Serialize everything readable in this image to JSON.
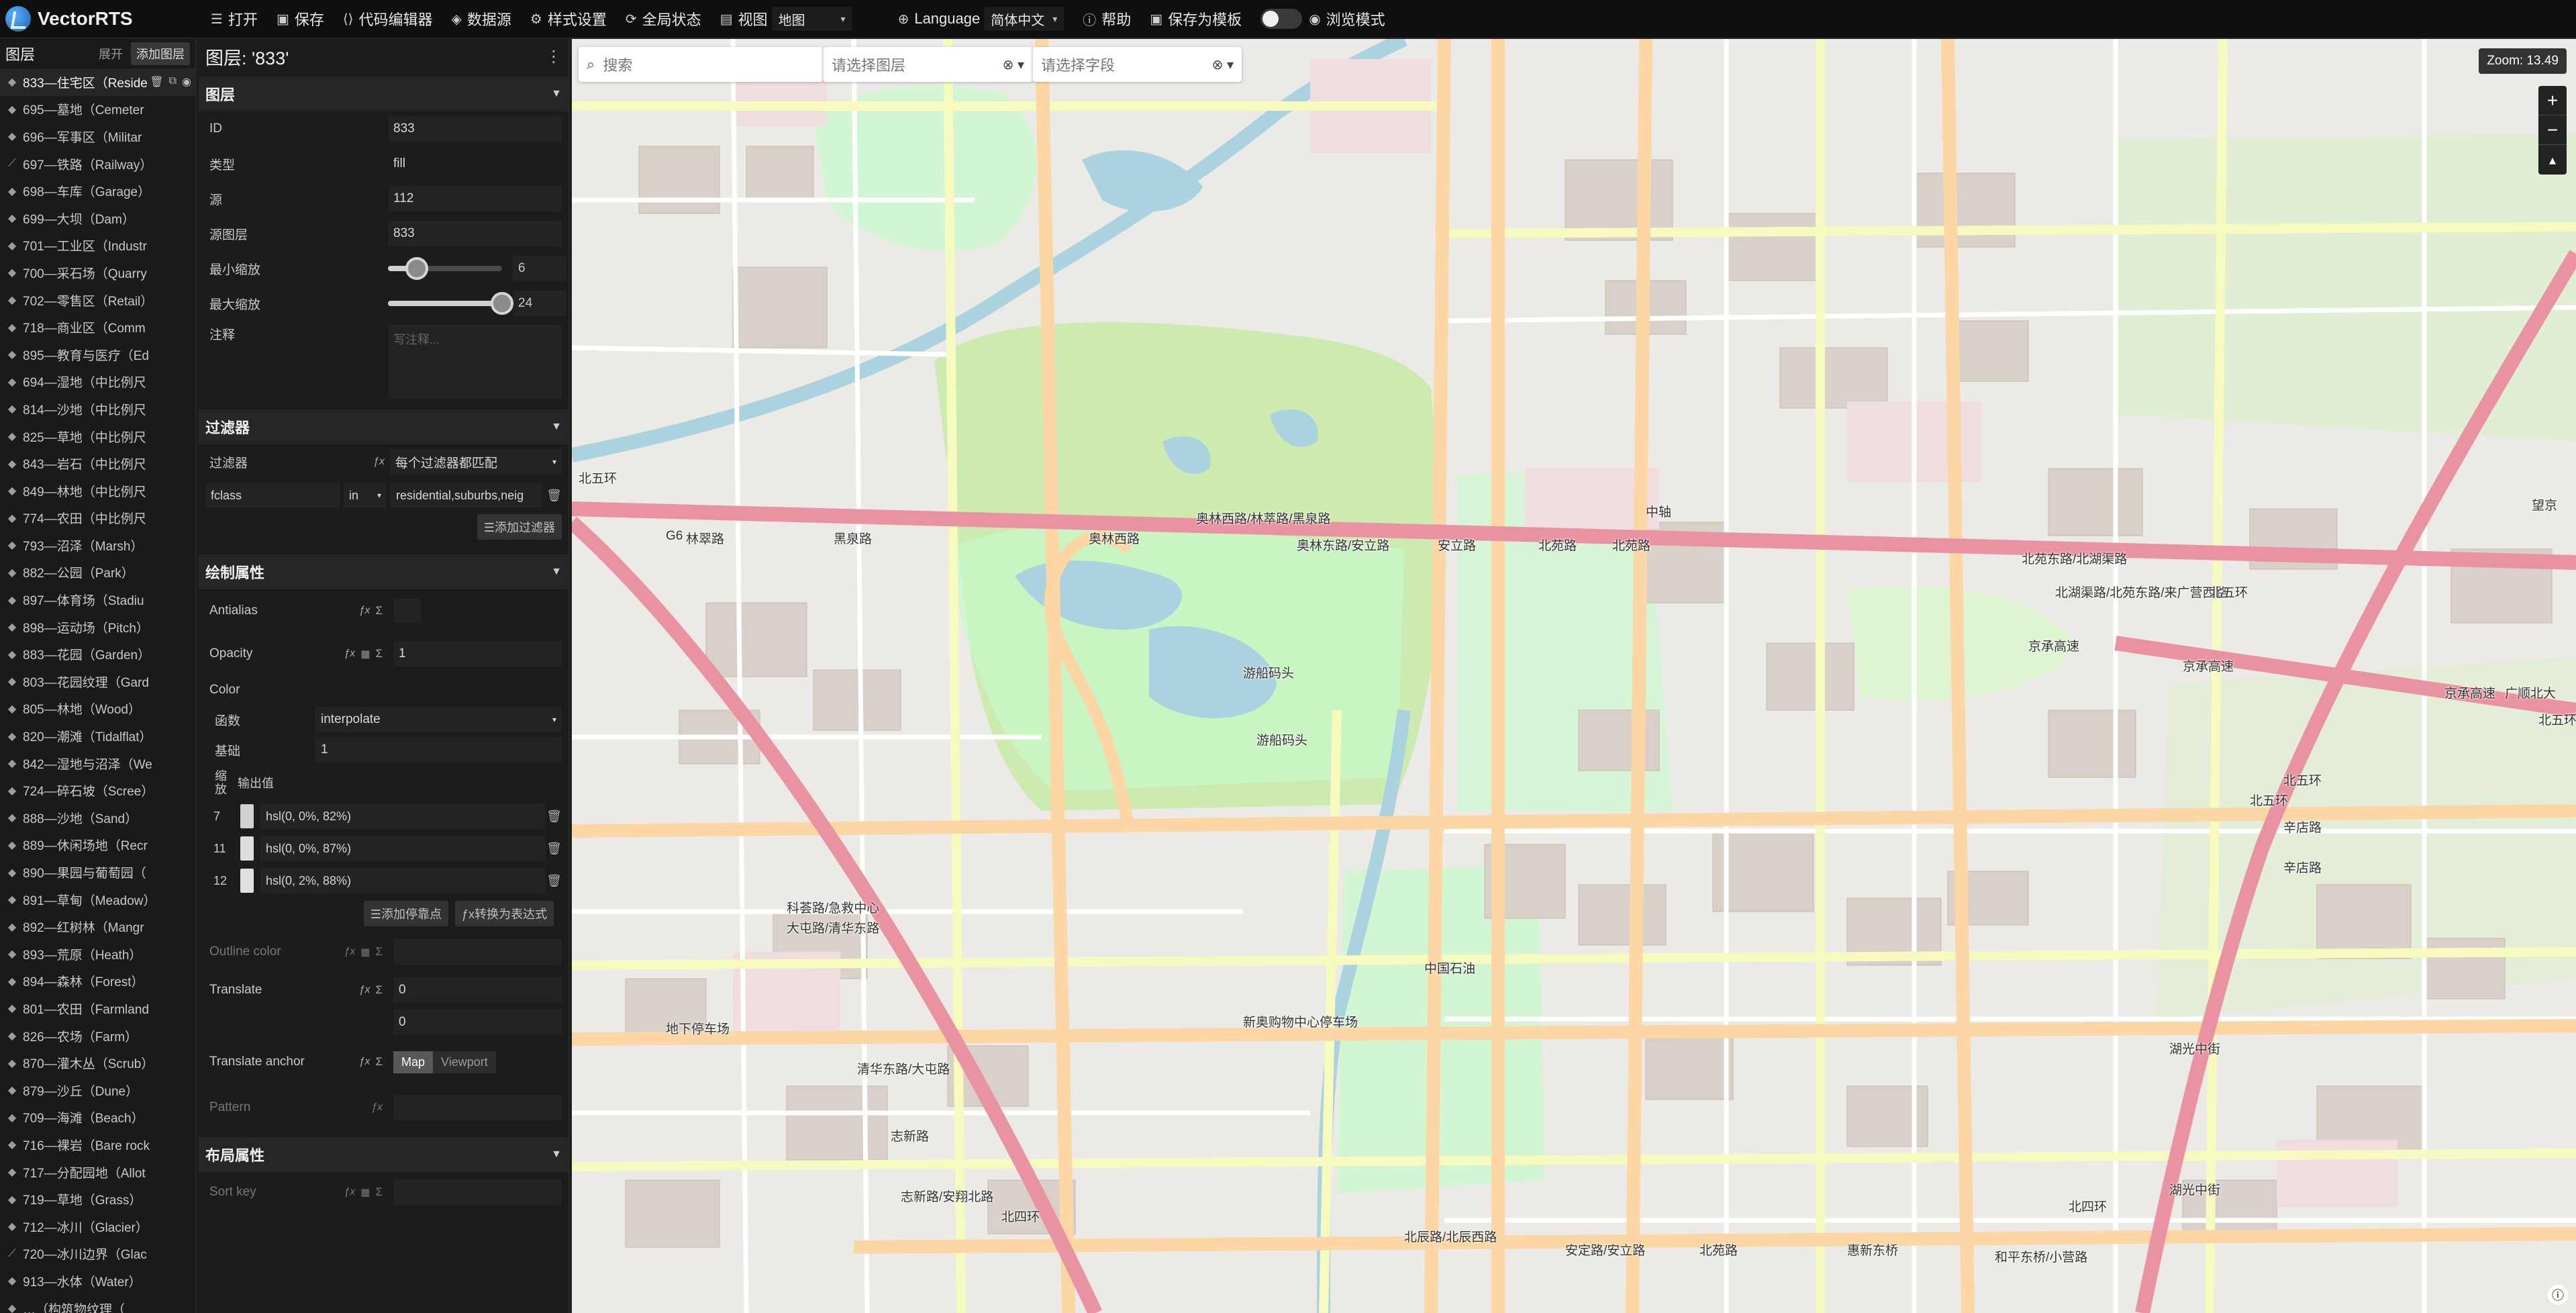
{
  "app": {
    "name": "VectorRTS"
  },
  "toolbar": {
    "open": "打开",
    "save": "保存",
    "code_editor": "代码编辑器",
    "datasource": "数据源",
    "style_settings": "样式设置",
    "global_state": "全局状态",
    "view": "视图",
    "view_select": "地图",
    "language": "Language",
    "language_select": "简体中文",
    "help": "帮助",
    "save_template": "保存为模板",
    "browse_mode": "浏览模式"
  },
  "layers_panel": {
    "title": "图层",
    "expand": "展开",
    "add": "添加图层",
    "items": [
      {
        "label": "833—住宅区（Reside",
        "icon": "fill"
      },
      {
        "label": "695—墓地（Cemeter",
        "icon": "fill"
      },
      {
        "label": "696—军事区（Militar",
        "icon": "fill"
      },
      {
        "label": "697—铁路（Railway）",
        "icon": "line"
      },
      {
        "label": "698—车库（Garage）",
        "icon": "fill"
      },
      {
        "label": "699—大坝（Dam）",
        "icon": "fill"
      },
      {
        "label": "701—工业区（Industr",
        "icon": "fill"
      },
      {
        "label": "700—采石场（Quarry",
        "icon": "fill"
      },
      {
        "label": "702—零售区（Retail）",
        "icon": "fill"
      },
      {
        "label": "718—商业区（Comm",
        "icon": "fill"
      },
      {
        "label": "895—教育与医疗（Ed",
        "icon": "fill"
      },
      {
        "label": "694—湿地（中比例尺",
        "icon": "fill"
      },
      {
        "label": "814—沙地（中比例尺",
        "icon": "fill"
      },
      {
        "label": "825—草地（中比例尺",
        "icon": "fill"
      },
      {
        "label": "843—岩石（中比例尺",
        "icon": "fill"
      },
      {
        "label": "849—林地（中比例尺",
        "icon": "fill"
      },
      {
        "label": "774—农田（中比例尺",
        "icon": "fill"
      },
      {
        "label": "793—沼泽（Marsh）",
        "icon": "fill"
      },
      {
        "label": "882—公园（Park）",
        "icon": "fill"
      },
      {
        "label": "897—体育场（Stadiu",
        "icon": "fill"
      },
      {
        "label": "898—运动场（Pitch）",
        "icon": "fill"
      },
      {
        "label": "883—花园（Garden）",
        "icon": "fill"
      },
      {
        "label": "803—花园纹理（Gard",
        "icon": "fill"
      },
      {
        "label": "805—林地（Wood）",
        "icon": "fill"
      },
      {
        "label": "820—潮滩（Tidalflat）",
        "icon": "fill"
      },
      {
        "label": "842—湿地与沼泽（We",
        "icon": "fill"
      },
      {
        "label": "724—碎石坡（Scree）",
        "icon": "fill"
      },
      {
        "label": "888—沙地（Sand）",
        "icon": "fill"
      },
      {
        "label": "889—休闲场地（Recr",
        "icon": "fill"
      },
      {
        "label": "890—果园与葡萄园（",
        "icon": "fill"
      },
      {
        "label": "891—草甸（Meadow）",
        "icon": "fill"
      },
      {
        "label": "892—红树林（Mangr",
        "icon": "fill"
      },
      {
        "label": "893—荒原（Heath）",
        "icon": "fill"
      },
      {
        "label": "894—森林（Forest）",
        "icon": "fill"
      },
      {
        "label": "801—农田（Farmland",
        "icon": "fill"
      },
      {
        "label": "826—农场（Farm）",
        "icon": "fill"
      },
      {
        "label": "870—灌木丛（Scrub）",
        "icon": "fill"
      },
      {
        "label": "879—沙丘（Dune）",
        "icon": "fill"
      },
      {
        "label": "709—海滩（Beach）",
        "icon": "fill"
      },
      {
        "label": "716—裸岩（Bare rock",
        "icon": "fill"
      },
      {
        "label": "717—分配园地（Allot",
        "icon": "fill"
      },
      {
        "label": "719—草地（Grass）",
        "icon": "fill"
      },
      {
        "label": "712—冰川（Glacier）",
        "icon": "fill"
      },
      {
        "label": "720—冰川边界（Glac",
        "icon": "line"
      },
      {
        "label": "913—水体（Water）",
        "icon": "fill"
      },
      {
        "label": "…（构筑物纹理（",
        "icon": "fill"
      }
    ]
  },
  "editor": {
    "title": "图层: '833'",
    "layer_section": "图层",
    "id_label": "ID",
    "id_value": "833",
    "type_label": "类型",
    "type_value": "fill",
    "source_label": "源",
    "source_value": "112",
    "source_layer_label": "源图层",
    "source_layer_value": "833",
    "minzoom_label": "最小缩放",
    "minzoom_value": "6",
    "minzoom_fraction": 0.25,
    "maxzoom_label": "最大缩放",
    "maxzoom_value": "24",
    "maxzoom_fraction": 1.0,
    "comment_label": "注释",
    "comment_placeholder": "写注释...",
    "filter_section": "过滤器",
    "filter_label": "过滤器",
    "filter_mode": "每个过滤器都匹配",
    "filter_field": "fclass",
    "filter_op": "in",
    "filter_values": "residential,suburbs,neig",
    "add_filter": "☰添加过滤器",
    "paint_section": "绘制属性",
    "antialias_label": "Antialias",
    "opacity_label": "Opacity",
    "opacity_placeholder": "1",
    "color_label": "Color",
    "function_label": "函数",
    "function_value": "interpolate",
    "base_label": "基础",
    "base_placeholder": "1",
    "zoom_header": "缩放",
    "output_header": "输出值",
    "stops": [
      {
        "zoom": "7",
        "color": "hsl(0, 0%, 82%)",
        "hex": "#d1d1d1"
      },
      {
        "zoom": "11",
        "color": "hsl(0, 0%, 87%)",
        "hex": "#dedede"
      },
      {
        "zoom": "12",
        "color": "hsl(0, 2%, 88%)",
        "hex": "#e1dfdf"
      }
    ],
    "add_stop": "☰添加停靠点",
    "to_expression": "ƒx转换为表达式",
    "outline_color_label": "Outline color",
    "translate_label": "Translate",
    "translate_x": "0",
    "translate_y": "0",
    "translate_anchor_label": "Translate anchor",
    "anchor_map": "Map",
    "anchor_viewport": "Viewport",
    "pattern_label": "Pattern",
    "layout_section": "布局属性",
    "sort_key_label": "Sort key"
  },
  "map": {
    "search_placeholder": "搜索",
    "layer_select_placeholder": "请选择图层",
    "field_select_placeholder": "请选择字段",
    "zoom_label": "Zoom: 13.49",
    "colors": {
      "water": "#aad3df",
      "park": "#c8facc",
      "wood": "#add19e",
      "road_major": "#e892a2",
      "road_secondary": "#f7fabf",
      "road_primary": "#fcd6a4",
      "building": "#d9d0c9",
      "residential": "#e0dfdf"
    },
    "labels": [
      "奥林西路/林萃路/黑泉路",
      "奥林东路/安立路",
      "安立路",
      "北苑路",
      "北苑路",
      "中轴",
      "黑泉路",
      "林翠路",
      "奥林西路",
      "北苑东路/北湖渠路",
      "北湖渠路/北苑东路/来广营西路",
      "京承高速",
      "京承高速",
      "京承高速",
      "北五环",
      "北五环",
      "北五环",
      "游船码头",
      "游船码头",
      "中国石油",
      "科荟路/急救中心",
      "大屯路/清华东路",
      "清华东路/大屯路",
      "新奥购物中心停车场",
      "地下停车场",
      "志新路",
      "志新路/安翔北路",
      "北四环",
      "北辰路/北辰西路",
      "安定路/安立路",
      "北苑路",
      "惠新东桥",
      "和平东桥/小营路",
      "湖光中街",
      "湖光中街",
      "北四环",
      "辛店路",
      "辛店路",
      "北五环",
      "望京",
      "广顺北大",
      "G6",
      "北五环"
    ]
  }
}
